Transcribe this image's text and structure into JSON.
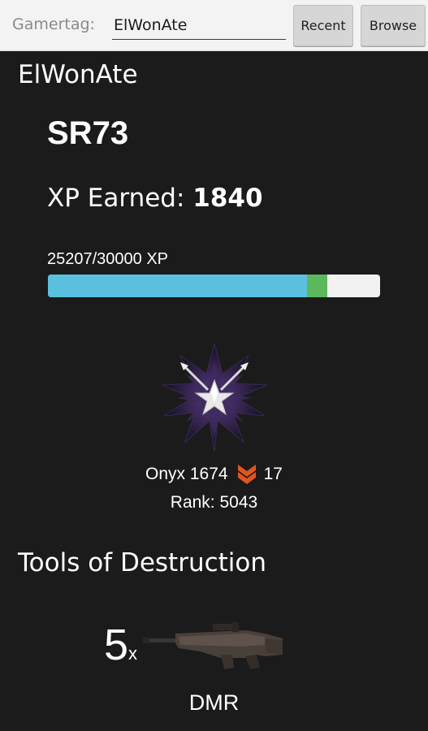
{
  "toolbar": {
    "gamertag_label": "Gamertag:",
    "gamertag_value": "ElWonAte",
    "recent_label": "Recent",
    "browse_label": "Browse"
  },
  "player": {
    "name": "ElWonAte",
    "sr": "SR73",
    "xp_earned_label": "XP Earned:",
    "xp_earned_value": "1840",
    "xp_progress_text": "25207/30000 XP",
    "xp_current": 25207,
    "xp_max": 30000,
    "xp_gain": 1840
  },
  "rank": {
    "tier_text": "Onyx 1674",
    "chevron_icon": "orange-chevron-icon",
    "chevron_count": "17",
    "rank_text": "Rank: 5043"
  },
  "tools": {
    "title": "Tools of Destruction",
    "count": "5",
    "multiplier": "x",
    "weapon_name": "DMR",
    "weapon_icon": "dmr-rifle-icon"
  },
  "colors": {
    "xp_bar_fill": "#5bc0de",
    "xp_bar_gain": "#5cb85c",
    "chevron": "#e2551f"
  }
}
